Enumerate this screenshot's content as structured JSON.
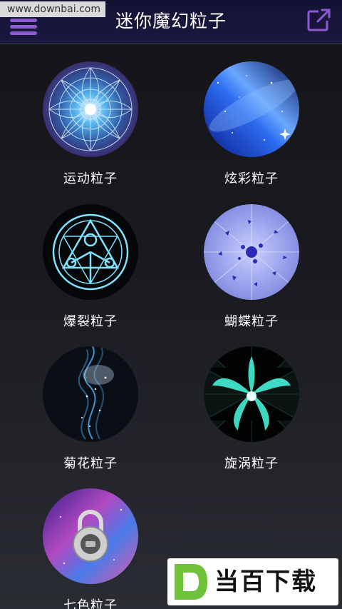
{
  "watermark_url": "www.downbai.com",
  "header": {
    "title": "迷你魔幻粒子"
  },
  "items": [
    {
      "label": "运动粒子",
      "icon": "mandala-image"
    },
    {
      "label": "炫彩粒子",
      "icon": "galaxy-image"
    },
    {
      "label": "爆裂粒子",
      "icon": "magic-circle-image"
    },
    {
      "label": "蝴蝶粒子",
      "icon": "shatter-image"
    },
    {
      "label": "菊花粒子",
      "icon": "particle-stream-image"
    },
    {
      "label": "旋涡粒子",
      "icon": "vortex-image"
    },
    {
      "label": "七色粒子",
      "icon": "padlock-nebula-image"
    }
  ],
  "logo": {
    "text": "当百下载",
    "letter": "D"
  },
  "colors": {
    "header_bg": "#1b1840",
    "accent": "#8c5bd1",
    "logo_green": "#6fc23a"
  }
}
